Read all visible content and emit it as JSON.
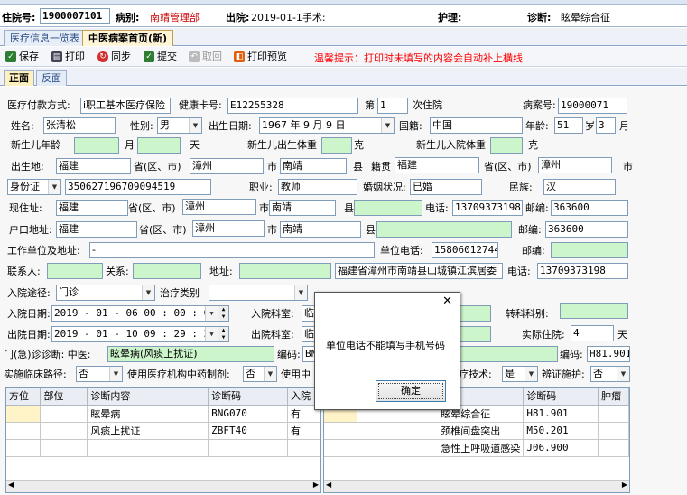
{
  "header": {
    "admission_no_label": "住院号:",
    "admission_no": "1900007101",
    "ward_label": "病别:",
    "ward": "南靖管理部",
    "discharge_label": "出院:",
    "discharge_value": "2019-01-1手术:",
    "nurse_label": "护理:",
    "diagnosis_label": "诊断:",
    "diagnosis": "眩晕综合征"
  },
  "tabs": [
    "医疗信息一览表",
    "中医病案首页(新)"
  ],
  "toolbar": {
    "save": "保存",
    "print": "打印",
    "sync": "同步",
    "submit": "提交",
    "recall": "取回",
    "preview": "打印预览",
    "notice": "温馨提示：打印时未填写的内容会自动补上横线"
  },
  "subtabs": [
    "正面",
    "反面"
  ],
  "form": {
    "pay_label": "医疗付款方式:",
    "pay_value": "i职工基本医疗保险",
    "card_label": "健康卡号:",
    "card_value": "E12255328",
    "times_prefix": "第",
    "times_value": "1",
    "times_suffix": "次住院",
    "record_label": "病案号:",
    "record_value": "19000071",
    "name_label": "姓名:",
    "name_value": "张清松",
    "sex_label": "性别:",
    "sex_value": "男",
    "birth_label": "出生日期:",
    "birth_value": "1967 年 9 月 9 日",
    "nation_label": "国籍:",
    "nation_value": "中国",
    "age_label": "年龄:",
    "age_value": "51",
    "age_unit": "岁",
    "month_value": "3",
    "month_unit": "月",
    "nb_age_label": "新生儿年龄",
    "nb_month_unit": "月",
    "nb_day_unit": "天",
    "nb_birth_weight_label": "新生儿出生体重",
    "gram1": "克",
    "nb_in_weight_label": "新生儿入院体重",
    "gram2": "克",
    "birthplace_label": "出生地:",
    "birthplace_prov": "福建",
    "prov_city_label": "省(区、市)",
    "birthplace_city": "漳州",
    "city_label": "市",
    "birthplace_county": "南靖",
    "county_label": "县",
    "native_label": "籍贯",
    "native_prov": "福建",
    "native_prov_city_label": "省(区、市)",
    "native_city": "漳州",
    "native_city_label": "市",
    "id_type": "身份证",
    "id_no": "350627196709094519",
    "job_label": "职业:",
    "job_value": "教师",
    "marital_label": "婚姻状况:",
    "marital_value": "已婚",
    "ethnic_label": "民族:",
    "ethnic_value": "汉",
    "cur_addr_label": "现住址:",
    "cur_prov": "福建",
    "cur_prov_label": "省(区、市)",
    "cur_city": "漳州",
    "cur_city_label": "市",
    "cur_county": "南靖",
    "cur_county_label": "县",
    "phone_label": "电话:",
    "phone_value": "13709373198",
    "post_label": "邮编:",
    "post_value": "363600",
    "reg_addr_label": "户口地址:",
    "reg_prov": "福建",
    "reg_prov_label": "省(区、市)",
    "reg_city": "漳州",
    "reg_city_label": "市",
    "reg_county": "南靖",
    "reg_county_label": "县",
    "reg_post_label": "邮编:",
    "reg_post_value": "363600",
    "work_label": "工作单位及地址:",
    "work_value": "-",
    "work_phone_label": "单位电话:",
    "work_phone_value": "15806012744",
    "work_post_label": "邮编:",
    "contact_label": "联系人:",
    "relation_label": "关系:",
    "addr_label": "地址:",
    "contact_addr": "福建省漳州市南靖县山城镇江滨居委",
    "contact_phone_label": "电话:",
    "contact_phone": "13709373198",
    "route_label": "入院途径:",
    "route_value": "门诊",
    "treat_label": "治疗类别",
    "adm_time_label": "入院日期:",
    "adm_time": "2019 - 01 - 06  00 : 00 : 00",
    "adm_dept_label": "入院科室:",
    "adm_dept_value": "临",
    "transfer_label": "转科科别:",
    "dis_time_label": "出院日期:",
    "dis_time": "2019 - 01 - 10  09 : 29 : 37",
    "dis_dept_label": "出院科室:",
    "dis_dept_value": "临",
    "days_label": "实际住院:",
    "days_value": "4",
    "days_unit": "天",
    "er_diag_label": "门(急)诊诊断: 中医:",
    "er_diag_value": "眩晕病(风痰上扰证)",
    "er_code_label": "编码:",
    "er_code_value": "BN",
    "er_code2_label": "编码:",
    "er_code2_value": "H81.901",
    "path_label": "实施临床路径:",
    "path_value": "否",
    "herb_label": "使用医疗机构中药制剂:",
    "herb_value": "否",
    "use_label": "使用中",
    "tech_label": "疗技术:",
    "tech_value": "是",
    "care_label": "辨证施护:",
    "care_value": "否"
  },
  "left_grid": {
    "headers": [
      "方位",
      "部位",
      "诊断内容",
      "诊断码",
      "入院"
    ],
    "rows": [
      [
        "",
        "",
        "眩晕病",
        "BNG070",
        "有"
      ],
      [
        "",
        "",
        "风痰上扰证",
        "ZBFT40",
        "有"
      ]
    ]
  },
  "right_grid": {
    "headers": [
      "",
      "",
      "诊断码",
      "肿瘤"
    ],
    "rows": [
      [
        "",
        "眩晕综合征",
        "H81.901",
        ""
      ],
      [
        "",
        "颈椎间盘突出",
        "M50.201",
        ""
      ],
      [
        "",
        "急性上呼吸道感染",
        "J06.900",
        ""
      ]
    ]
  },
  "dialog": {
    "message": "单位电话不能填写手机号码",
    "ok": "确定",
    "close": "✕"
  },
  "colors": {
    "required": "#ccf5cc",
    "notice": "#ff0000",
    "header_red": "#cc0000"
  }
}
